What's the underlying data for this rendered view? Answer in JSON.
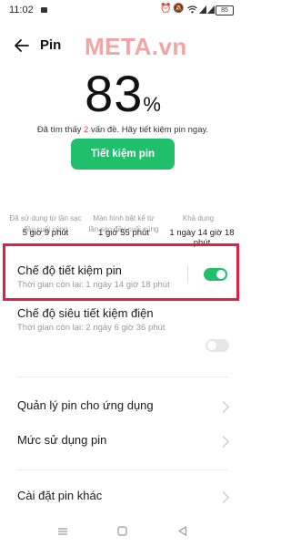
{
  "status_bar": {
    "time": "11:02",
    "right_icons": [
      "alarm-icon",
      "mute-icon",
      "wifi-icon",
      "signal-icon",
      "signal-icon"
    ],
    "battery_level": "85"
  },
  "header": {
    "title": "Pin",
    "watermark": "META.vn"
  },
  "battery": {
    "percent": "83",
    "percent_symbol": "%"
  },
  "issues": {
    "prefix": "Đã tìm thấy ",
    "count": "2",
    "suffix": " vấn đề. Hãy tiết kiệm pin ngay."
  },
  "save_button": "Tiết kiệm pin",
  "stats": [
    {
      "label": "Đã sử dụng từ lần sạc đầy cuối cùng",
      "value": "5 giờ 9 phút"
    },
    {
      "label": "Màn hình bật kể từ lần sạc đầy cuối cùng",
      "value": "1 giờ 55 phút"
    },
    {
      "label": "Khả dụng",
      "value": "1 ngày 14 giờ 18 phút"
    }
  ],
  "power_saving": {
    "title": "Chế độ tiết kiệm pin",
    "subtitle": "Thời gian còn lại: 1 ngày 14 giờ 18 phút",
    "enabled": true
  },
  "super_saving": {
    "title": "Chế độ siêu tiết kiệm điện",
    "subtitle": "Thời gian còn lại: 2 ngày 6 giờ 36 phút",
    "enabled": false
  },
  "menu": [
    {
      "label": "Quản lý pin cho ứng dụng"
    },
    {
      "label": "Mức sử dụng pin"
    },
    {
      "label": "Cài đặt pin khác"
    }
  ],
  "colors": {
    "accent_green": "#1fbf6b",
    "highlight_red": "#e51e48",
    "warning_red": "#e8453c"
  }
}
